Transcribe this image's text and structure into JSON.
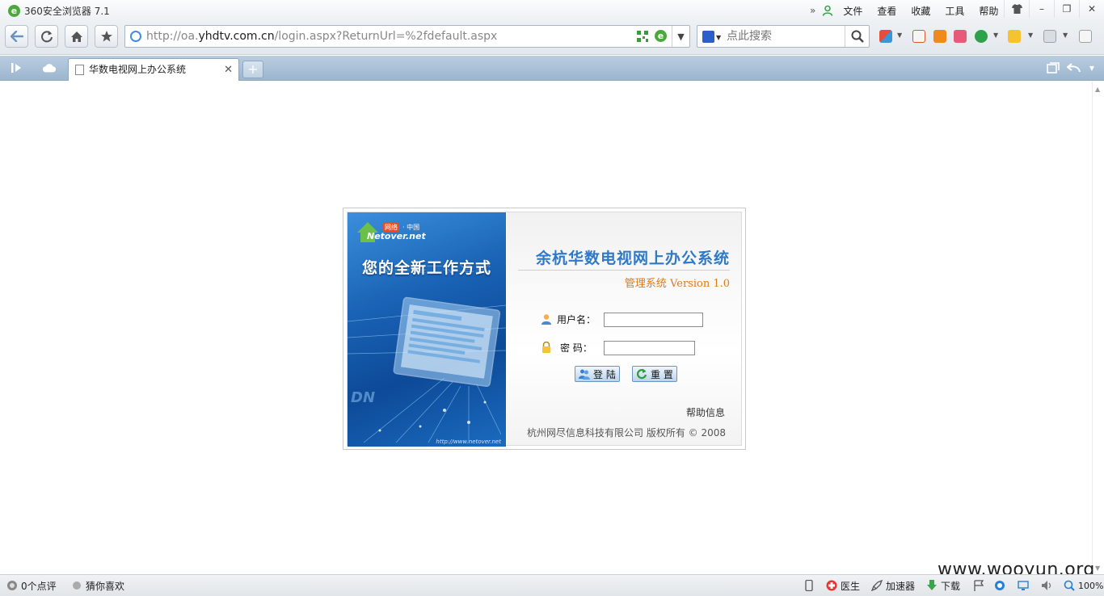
{
  "window": {
    "title": "360安全浏览器 7.1",
    "menu": [
      "文件",
      "查看",
      "收藏",
      "工具",
      "帮助"
    ],
    "controls": {
      "minimize": "–",
      "restore": "❐",
      "close": "✕",
      "skin": "👕"
    }
  },
  "toolbar": {
    "url_prefix": "http://oa.",
    "url_domain": "yhdtv.com.cn",
    "url_path": "/login.aspx?ReturnUrl=%2fdefault.aspx",
    "search_placeholder": "点此搜索"
  },
  "tabs": [
    {
      "title": "华数电视网上办公系统",
      "close": "✕"
    }
  ],
  "new_tab": "+",
  "login": {
    "banner": {
      "logo_text": "Netover.net",
      "logo_badge": "网络",
      "logo_cn": "· 中国",
      "slogan": "您的全新工作方式",
      "url": "http://www.netover.net"
    },
    "system_title": "余杭华数电视网上办公系统",
    "subtitle": "管理系统  Version 1.0",
    "username_label": "用户名：",
    "password_label": "密  码：",
    "username_value": "",
    "password_value": "",
    "login_button": "登 陆",
    "reset_button": "重 置",
    "help_link": "帮助信息",
    "copyright": "杭州网尽信息科技有限公司  版权所有  © 2008"
  },
  "statusbar": {
    "comments": "0个点评",
    "recommend": "猜你喜欢",
    "doctor": "医生",
    "accelerator": "加速器",
    "download": "下载",
    "zoom": "100%"
  },
  "watermark": "www.wooyun.org",
  "colors": {
    "accent_blue": "#2f79c7",
    "subtitle_orange": "#e07b1a",
    "tabbar": "#a9c2d9"
  }
}
